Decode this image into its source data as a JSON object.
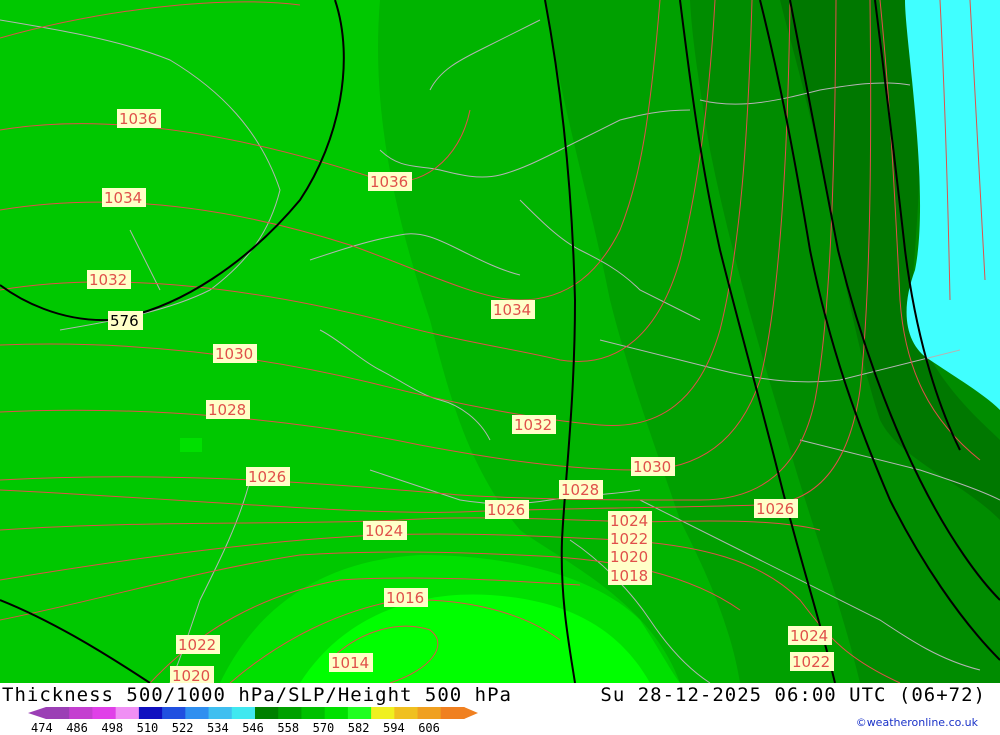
{
  "title": "Thickness 500/1000 hPa/SLP/Height 500 hPa",
  "datetime": "Su 28-12-2025 06:00 UTC (06+72)",
  "credit": "©weatheronline.co.uk",
  "colorbar": {
    "ticks": [
      "474",
      "486",
      "498",
      "510",
      "522",
      "534",
      "546",
      "558",
      "570",
      "582",
      "594",
      "606"
    ],
    "colors": [
      "#9b3fb5",
      "#c43fd0",
      "#e040e8",
      "#f08ff4",
      "#1010c0",
      "#2050e0",
      "#2f8ff0",
      "#40bff0",
      "#40e8f0",
      "#008000",
      "#00a000",
      "#00c000",
      "#00e000",
      "#20ff20",
      "#f0f020",
      "#f0c020",
      "#f0a020",
      "#f08020"
    ]
  },
  "slp_labels": [
    "1036",
    "1036",
    "1034",
    "1034",
    "1032",
    "1032",
    "1030",
    "1030",
    "1028",
    "1028",
    "1026",
    "1026",
    "1026",
    "1024",
    "1024",
    "1024",
    "1022",
    "1022",
    "1022",
    "1020",
    "1020",
    "1018",
    "1016",
    "1014"
  ],
  "height_labels": [
    "576"
  ],
  "colors": {
    "c1": "#00c800",
    "c2": "#00b400",
    "c3": "#00a000",
    "c4": "#008c00",
    "c5": "#007800",
    "bright": "#00ff00",
    "cyan": "#40ffff",
    "isobar": "#e0504a",
    "border": "#b4b4b4"
  }
}
